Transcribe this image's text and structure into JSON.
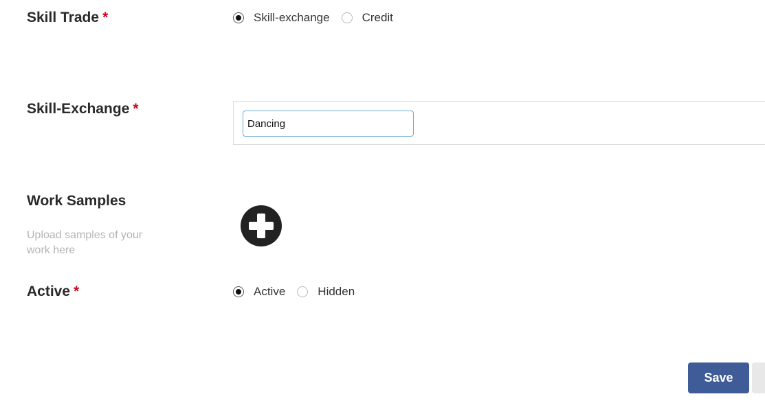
{
  "skill_trade": {
    "label": "Skill Trade",
    "required_mark": "*",
    "options": [
      {
        "label": "Skill-exchange",
        "checked": true
      },
      {
        "label": "Credit",
        "checked": false
      }
    ]
  },
  "skill_exchange": {
    "label": "Skill-Exchange",
    "required_mark": "*",
    "input_value": "Dancing"
  },
  "work_samples": {
    "label": "Work Samples",
    "help_text": "Upload samples of your work here",
    "add_icon": "plus-circle-icon"
  },
  "active": {
    "label": "Active",
    "required_mark": "*",
    "options": [
      {
        "label": "Active",
        "checked": true
      },
      {
        "label": "Hidden",
        "checked": false
      }
    ]
  },
  "actions": {
    "save_label": "Save"
  },
  "colors": {
    "required": "#d0021b",
    "save_button": "#3f5b98",
    "input_focus_border": "#69a9d6"
  }
}
